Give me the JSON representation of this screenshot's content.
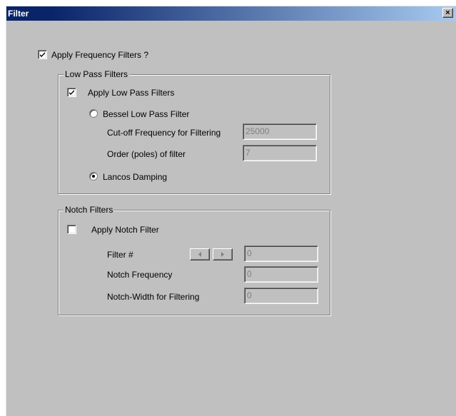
{
  "window": {
    "title": "Filter",
    "close_label": "×"
  },
  "apply_frequency": {
    "label": "Apply Frequency Filters ?",
    "checked": true
  },
  "low_pass": {
    "group_title": "Low Pass Filters",
    "apply": {
      "label": "Apply Low Pass Filters",
      "checked": true
    },
    "bessel": {
      "label": "Bessel Low Pass Filter",
      "selected": false
    },
    "cutoff": {
      "label": "Cut-off Frequency for Filtering",
      "value": "25000"
    },
    "order": {
      "label": "Order (poles) of filter",
      "value": "7"
    },
    "lancos": {
      "label": "Lancos Damping",
      "selected": true
    }
  },
  "notch": {
    "group_title": "Notch Filters",
    "apply": {
      "label": "Apply Notch Filter",
      "checked": false
    },
    "filter_num": {
      "label": "Filter #",
      "value": "0"
    },
    "frequency": {
      "label": "Notch Frequency",
      "value": "0"
    },
    "width": {
      "label": "Notch-Width for Filtering",
      "value": "0"
    }
  },
  "colors": {
    "title_bar": "#0a246a",
    "face": "#c0c0c0",
    "disabled_text": "#808080"
  }
}
